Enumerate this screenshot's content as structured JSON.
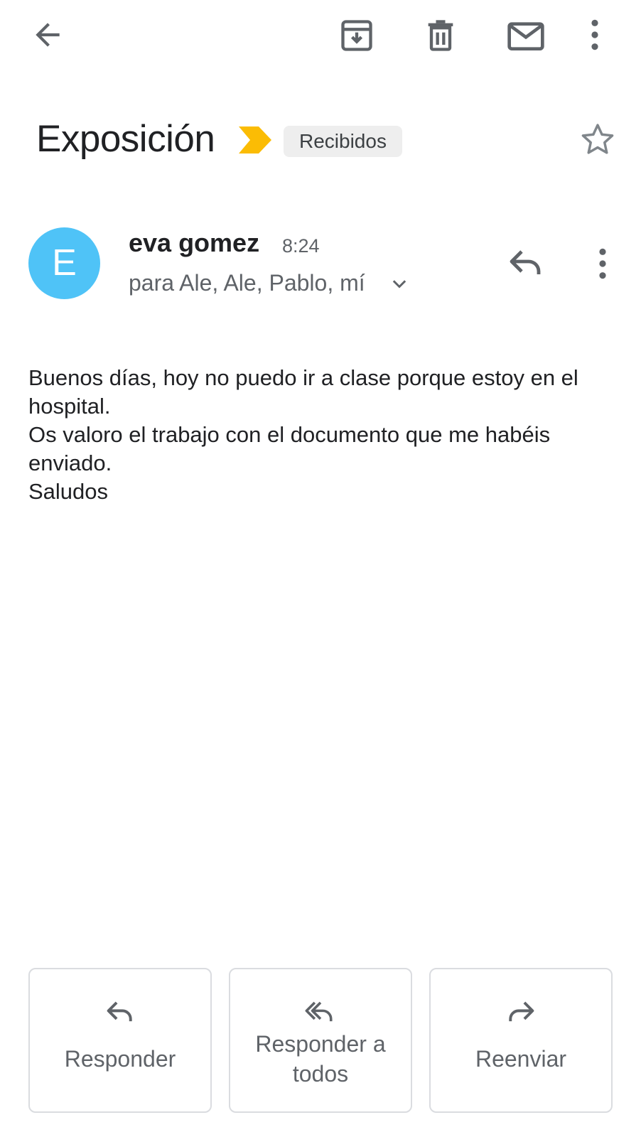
{
  "toolbar": {
    "icons": [
      "back-arrow-icon",
      "archive-icon",
      "delete-icon",
      "mark-unread-icon",
      "more-vert-icon"
    ]
  },
  "email": {
    "subject": "Exposición",
    "label": "Recibidos",
    "importance_color": "#fbbc04",
    "sender": {
      "initial": "E",
      "name": "eva gomez",
      "time": "8:24",
      "recipients": "para Ale, Ale, Pablo, mí",
      "avatar_color": "#4fc3f7"
    },
    "body": {
      "line1": "Buenos días, hoy no puedo ir a clase porque estoy en el hospital.",
      "line2": "Os valoro el trabajo con el documento que me habéis enviado.",
      "line3": "Saludos"
    }
  },
  "actions": {
    "reply": "Responder",
    "reply_all_line1": "Responder a",
    "reply_all_line2": "todos",
    "forward": "Reenviar"
  }
}
